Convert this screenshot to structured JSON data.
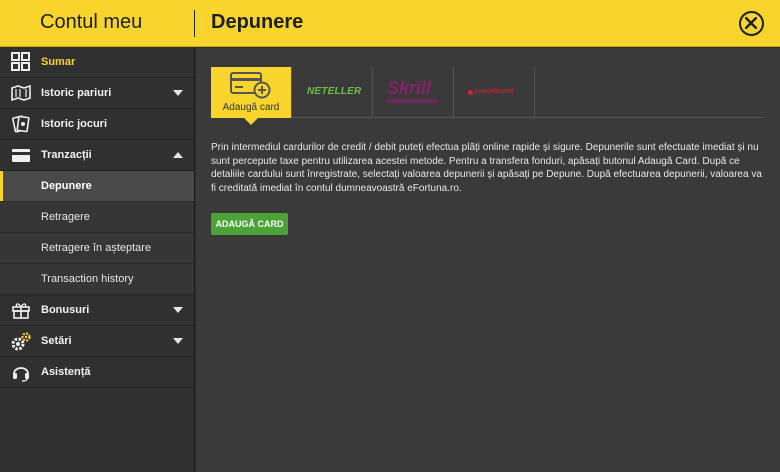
{
  "header": {
    "left_title": "Contul meu",
    "page_title": "Depunere",
    "close_icon": "close-circle-icon"
  },
  "sidebar": {
    "items": [
      {
        "label": "Sumar",
        "icon": "grid-icon",
        "active": true
      },
      {
        "label": "Istoric pariuri",
        "icon": "ticket-icon",
        "chevron": "down"
      },
      {
        "label": "Istoric jocuri",
        "icon": "cards-icon"
      },
      {
        "label": "Tranzacții",
        "icon": "wallet-icon",
        "chevron": "up"
      }
    ],
    "sub_items": [
      {
        "label": "Depunere",
        "selected": true
      },
      {
        "label": "Retragere"
      },
      {
        "label": "Retragere în așteptare"
      },
      {
        "label": "Transaction history"
      }
    ],
    "items_bottom": [
      {
        "label": "Bonusuri",
        "icon": "gift-icon",
        "chevron": "down"
      },
      {
        "label": "Setări",
        "icon": "gears-icon",
        "chevron": "down"
      },
      {
        "label": "Asistență",
        "icon": "headset-icon"
      }
    ]
  },
  "tabs": [
    {
      "label": "Adaugă card",
      "icon": "add-card-icon",
      "active": true
    },
    {
      "brand": "NETELLER"
    },
    {
      "brand": "Skrill"
    },
    {
      "brand": "paysafecard"
    }
  ],
  "content": {
    "description": "Prin intermediul cardurilor de credit / debit puteți efectua plăți online rapide și sigure. Depunerile sunt efectuate imediat și nu sunt percepute taxe pentru utilizarea acestei metode. Pentru a transfera fonduri, apăsați butonul Adaugă Card. După ce detaliile cardului sunt înregistrate, selectați valoarea depunerii și apăsați pe Depune. După efectuarea depunerii, valoarea va fi creditată imediat în contul dumneavoastră eFortuna.ro.",
    "add_card_button": "ADAUGĂ CARD"
  },
  "colors": {
    "accent": "#f7d52c",
    "button_green": "#4ba335",
    "sidebar_bg": "#303030",
    "content_bg": "#3a3a3a"
  }
}
